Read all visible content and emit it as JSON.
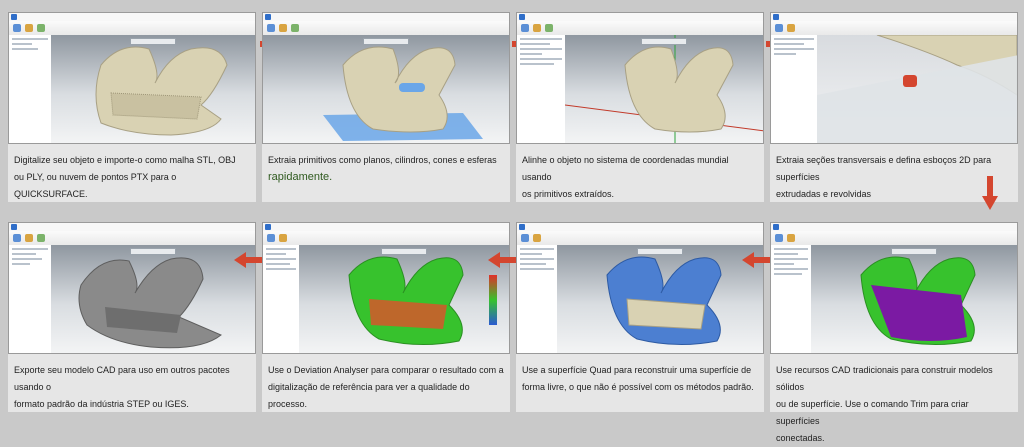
{
  "colors": {
    "background": "#c9c9c9",
    "panel": "#e6e6e6",
    "arrow": "#d4462f",
    "model_beige": "#d9d2b3",
    "deviation_green": "#37c22d",
    "deviation_red": "#e0502a",
    "quad_blue": "#4c7fd1",
    "surface_purple": "#7b1aa3",
    "cad_gray": "#8a8a8a",
    "plane_blue": "#6aa6e8"
  },
  "icons": {
    "flow_arrow": "red-arrow-icon",
    "app_logo": "quicksurface-logo-icon"
  },
  "steps": [
    {
      "caption_lines": [
        "Digitalize seu objeto e importe-o como malha STL, OBJ",
        "ou PLY, ou nuvem de pontos PTX para o QUICKSURFACE."
      ]
    },
    {
      "caption_lines": [
        "Extraia primitivos como planos, cilindros, cones e esferas"
      ],
      "caption_emph": "rapidamente."
    },
    {
      "caption_lines": [
        "Alinhe o objeto no sistema de coordenadas mundial usando",
        "os primitivos extraídos."
      ]
    },
    {
      "caption_lines": [
        "Extraia seções transversais e defina esboços 2D para superfícies",
        "extrudadas e revolvidas"
      ]
    },
    {
      "caption_lines": [
        "Use recursos CAD tradicionais para construir modelos sólidos",
        "ou de superfície. Use o comando Trim para criar superfícies",
        "conectadas."
      ]
    },
    {
      "caption_lines": [
        "Use a superfície Quad para reconstruir uma superfície de",
        "forma livre, o que não é possível com os métodos padrão."
      ]
    },
    {
      "caption_lines": [
        "Use o Deviation Analyser para comparar o resultado com a",
        "digitalização de referência para ver a qualidade do processo."
      ]
    },
    {
      "caption_lines": [
        "Exporte seu modelo CAD para uso em outros pacotes usando o",
        "formato padrão da indústria STEP ou IGES."
      ]
    }
  ]
}
